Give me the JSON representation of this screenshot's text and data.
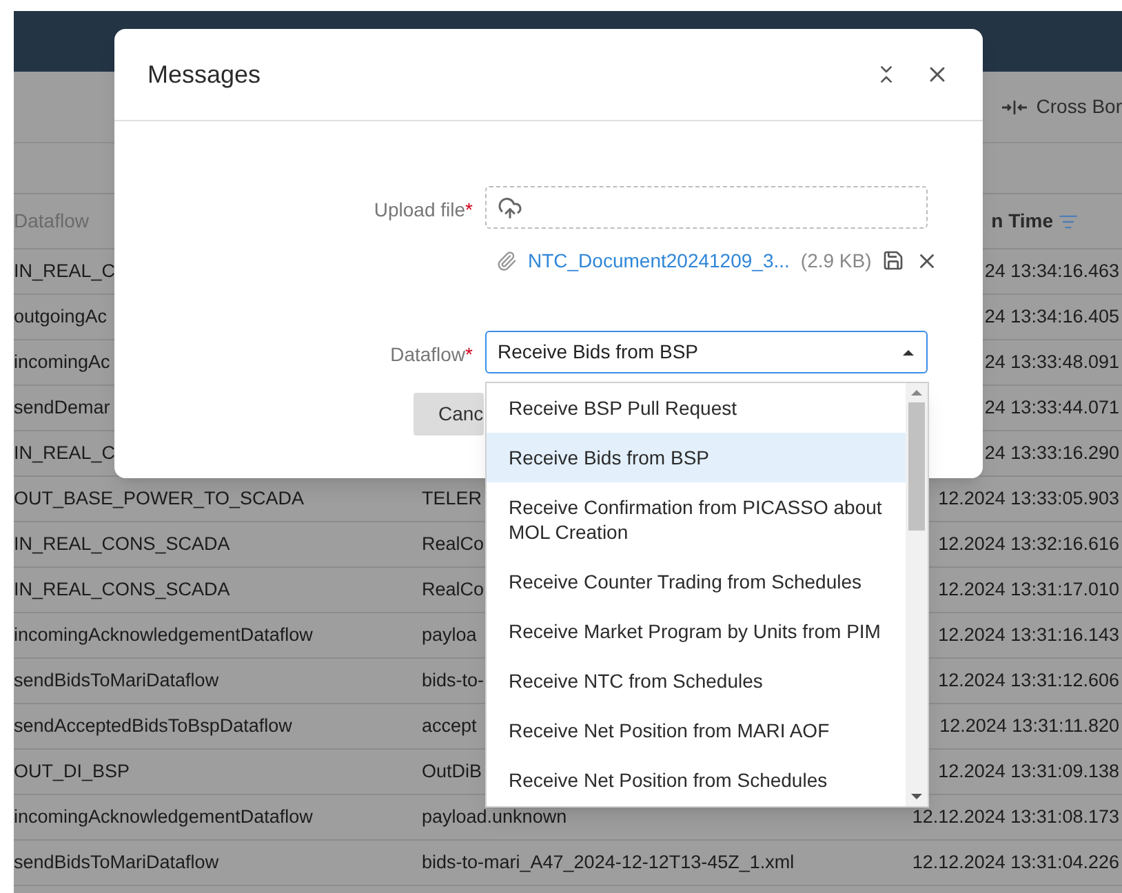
{
  "toolbar": {
    "action": "Cross Bor"
  },
  "table": {
    "columns": [
      {
        "label": "Dataflow",
        "sorted": false
      },
      {
        "label": "n Time",
        "sorted": true
      }
    ],
    "rows": [
      {
        "dataflow": "IN_REAL_C",
        "time": "24 13:34:16.463"
      },
      {
        "dataflow": "outgoingAc",
        "time": "24 13:34:16.405"
      },
      {
        "dataflow": "incomingAc",
        "time": "24 13:33:48.091"
      },
      {
        "dataflow": "sendDemar",
        "time": "24 13:33:44.071"
      },
      {
        "dataflow": "IN_REAL_C",
        "time": "24 13:33:16.290"
      },
      {
        "dataflow": "OUT_BASE_POWER_TO_SCADA",
        "column_2": "TELER",
        "time": "12.2024 13:33:05.903"
      },
      {
        "dataflow": "IN_REAL_CONS_SCADA",
        "column_2": "RealCo",
        "time": "12.2024 13:32:16.616"
      },
      {
        "dataflow": "IN_REAL_CONS_SCADA",
        "column_2": "RealCo",
        "time": "12.2024 13:31:17.010"
      },
      {
        "dataflow": "incomingAcknowledgementDataflow",
        "column_2": "payloa",
        "time": "12.2024 13:31:16.143"
      },
      {
        "dataflow": "sendBidsToMariDataflow",
        "column_2": "bids-to-",
        "time": "12.2024 13:31:12.606"
      },
      {
        "dataflow": "sendAcceptedBidsToBspDataflow",
        "column_2": "accept",
        "time": "12.2024 13:31:11.820"
      },
      {
        "dataflow": "OUT_DI_BSP",
        "column_2": "OutDiB",
        "time": "12.2024 13:31:09.138"
      },
      {
        "dataflow": "incomingAcknowledgementDataflow",
        "column_2": "payload.unknown",
        "time": "12.12.2024 13:31:08.173"
      },
      {
        "dataflow": "sendBidsToMariDataflow",
        "column_2": "bids-to-mari_A47_2024-12-12T13-45Z_1.xml",
        "time": "12.12.2024 13:31:04.226"
      }
    ]
  },
  "dialog": {
    "title": "Messages",
    "upload": {
      "label": "Upload file",
      "required_mark": "*"
    },
    "file": {
      "name": "NTC_Document20241209_3...",
      "size": "(2.9 KB)"
    },
    "dataflow": {
      "label": "Dataflow",
      "required_mark": "*",
      "value": "Receive Bids from BSP",
      "expanded": true,
      "options": [
        {
          "label": "Receive BSP Pull Request",
          "selected": false
        },
        {
          "label": "Receive Bids from BSP",
          "selected": true
        },
        {
          "label": "Receive Confirmation from PICASSO about MOL Creation",
          "selected": false
        },
        {
          "label": "Receive Counter Trading from Schedules",
          "selected": false
        },
        {
          "label": "Receive Market Program by Units from PIM",
          "selected": false
        },
        {
          "label": "Receive NTC from Schedules",
          "selected": false
        },
        {
          "label": "Receive Net Position from MARI AOF",
          "selected": false
        },
        {
          "label": "Receive Net Position from Schedules",
          "selected": false
        }
      ]
    },
    "buttons": [
      "Canc"
    ]
  }
}
